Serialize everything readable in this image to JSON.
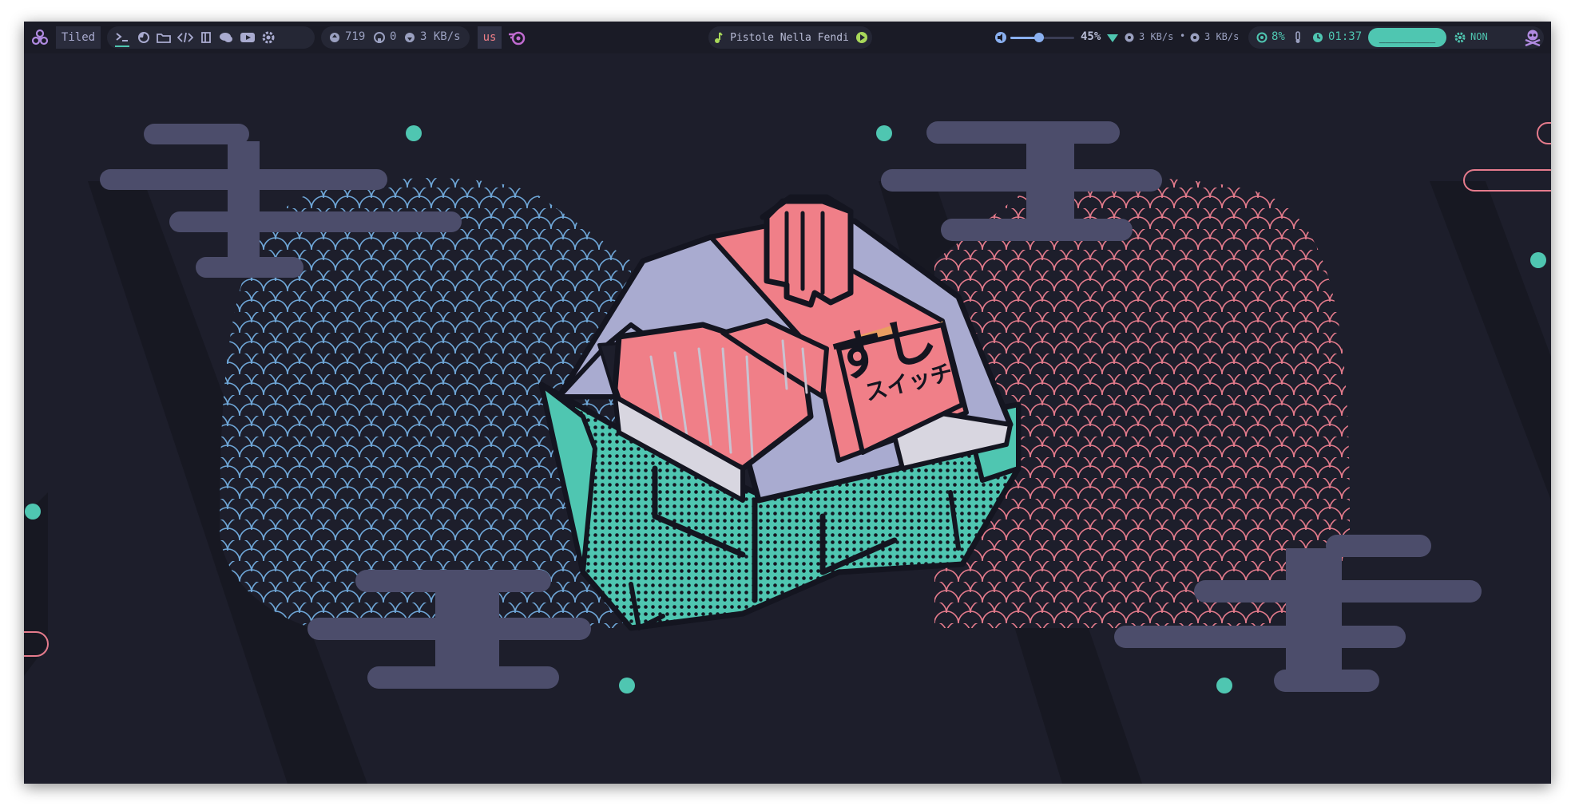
{
  "topbar": {
    "layout_label": "Tiled",
    "workspace_icons": [
      "terminal-icon",
      "firefox-icon",
      "folder-icon",
      "code-icon",
      "notes-icon",
      "chat-icon",
      "youtube-icon",
      "settings-icon"
    ],
    "updates_count": "719",
    "github_count": "0",
    "net_speed_left": "3 KB/s",
    "keyboard_layout": "us",
    "now_playing": "Pistole Nella Fendi",
    "volume_percent": "45%",
    "volume_level": 0.45,
    "net_down": "3 KB/s",
    "net_sep": "•",
    "net_up": "3 KB/s",
    "cpu_percent": "8%",
    "clock": "01:37 PM",
    "search_placeholder": "_________",
    "mode_label": "NON"
  },
  "wallpaper": {
    "kana_large": "すし",
    "kana_small": "スイッチ"
  },
  "colors": {
    "bar_bg": "#1a1b26",
    "desktop_bg": "#1d1e2b",
    "accent_teal": "#4fc6b1",
    "accent_pink": "#f07f88",
    "accent_purple": "#b08ae0",
    "cloud": "#4c4d6b",
    "lavender": "#a9abd0"
  }
}
